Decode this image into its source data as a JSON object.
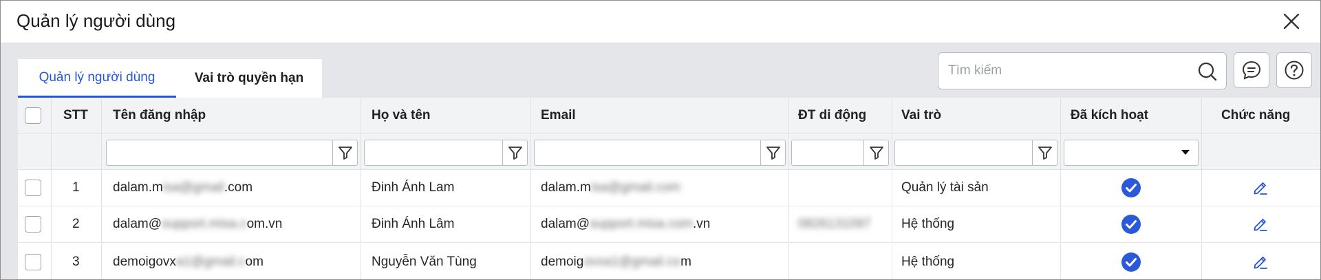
{
  "window": {
    "title": "Quản lý người dùng"
  },
  "tabs": [
    {
      "label": "Quản lý người dùng",
      "active": true
    },
    {
      "label": "Vai trò quyền hạn",
      "active": false
    }
  ],
  "search": {
    "placeholder": "Tìm kiếm",
    "value": ""
  },
  "toolbar": {
    "icons": [
      "search-icon",
      "chat-icon",
      "help-icon"
    ]
  },
  "table": {
    "columns": [
      {
        "key": "select",
        "label": ""
      },
      {
        "key": "stt",
        "label": "STT"
      },
      {
        "key": "username",
        "label": "Tên đăng nhập"
      },
      {
        "key": "fullname",
        "label": "Họ và tên"
      },
      {
        "key": "email",
        "label": "Email"
      },
      {
        "key": "mobile",
        "label": "ĐT di động"
      },
      {
        "key": "role",
        "label": "Vai trò"
      },
      {
        "key": "activated",
        "label": "Đã kích hoạt"
      },
      {
        "key": "actions",
        "label": "Chức năng"
      }
    ],
    "filters": {
      "username": "",
      "fullname": "",
      "email": "",
      "mobile": "",
      "role": "",
      "activated": ""
    },
    "rows": [
      {
        "stt": "1",
        "username_prefix": "dalam.m",
        "username_blur": "isa@gmail",
        "username_suffix": ".com",
        "fullname": "Đinh Ánh Lam",
        "email_prefix": "dalam.m",
        "email_blur": "isa@gmail.com",
        "email_suffix": "",
        "mobile": "",
        "role": "Quản lý tài sản",
        "activated": true
      },
      {
        "stt": "2",
        "username_prefix": "dalam@",
        "username_blur": "support.misa.c",
        "username_suffix": "om.vn",
        "fullname": "Đinh Ánh Lâm",
        "email_prefix": "dalam@",
        "email_blur": "support.misa.com",
        "email_suffix": ".vn",
        "mobile": "0826131097",
        "role": "Hệ thống",
        "activated": true
      },
      {
        "stt": "3",
        "username_prefix": "demoigovx",
        "username_blur": "a1@gmail.c",
        "username_suffix": "om",
        "fullname": "Nguyễn Văn Tùng",
        "email_prefix": "demoig",
        "email_blur": "ovxa1@gmail.co",
        "email_suffix": "m",
        "mobile": "",
        "role": "Hệ thống",
        "activated": true
      }
    ]
  },
  "colors": {
    "accent": "#2456d6",
    "check": "#2a5ad8",
    "header_bg": "#f2f3f5",
    "page_bg": "#e4e6ea"
  }
}
